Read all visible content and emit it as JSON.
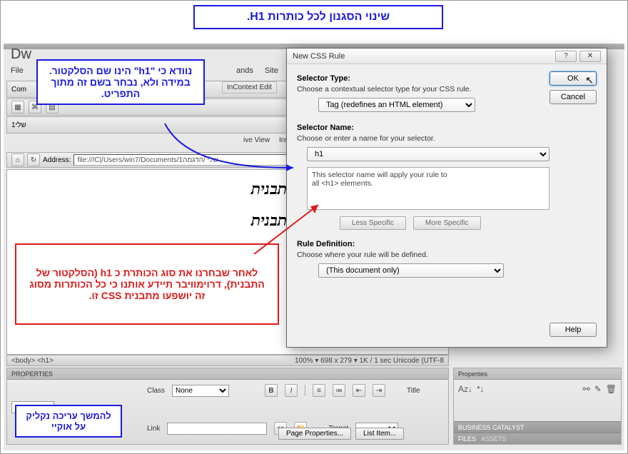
{
  "annotations": {
    "top": "שינוי הסגנון לכל כותרות H1.",
    "note1": "נוודא כי \"h1\" הינו שם הסלקטור. במידה ולא, נבחר בשם זה מתוך התפריט.",
    "note2": "לאחר שבחרנו את סוג הכותרת כ h1 (הסלקטור של התבנית), דרוימוויבר תיידע אותנו כי כל הכותרות מסוג זה יושפעו מתבנית CSS זו.",
    "note3": "להמשך עריכה נקליק על אוקיי"
  },
  "app": {
    "title": "Dw"
  },
  "menu": {
    "file": "File",
    "commands": "ands",
    "site": "Site",
    "incontext": "InContext Edit"
  },
  "toolbar": {
    "common": "Com",
    "tab_sheli": "שלי1",
    "liveview": "ive View",
    "ins": "Ins"
  },
  "addressbar": {
    "label": "Address:",
    "value": "file:///C|/Users/win7/Documents/1שלי /הדגמה"
  },
  "document": {
    "line1": "ות מוגדרות על ידי אותה התבנית",
    "line2": "ות מוגדרות על ידי אותה התבנית"
  },
  "status": {
    "tags": "<body> <h1>",
    "info": "100%  ▾  698 x 279 ▾  1K / 1 sec  Unicode (UTF-8"
  },
  "properties": {
    "title": "PROPERTIES",
    "class_lbl": "Class",
    "class_val": "None",
    "link_lbl": "Link",
    "title_lbl": "Title",
    "target_lbl": "Target",
    "page_props_btn": "Page Properties...",
    "list_item_btn": "List Item..."
  },
  "sidepanel": {
    "props": "Properties",
    "bc": "BUSINESS CATALYST",
    "files": "FILES",
    "assets": "ASSETS"
  },
  "dialog": {
    "title": "New CSS Rule",
    "selector_type_lbl": "Selector Type:",
    "selector_type_sub": "Choose a contextual selector type for your CSS rule.",
    "selector_type_val": "Tag (redefines an HTML element)",
    "selector_name_lbl": "Selector Name:",
    "selector_name_sub": "Choose or enter a name for your selector.",
    "selector_name_val": "h1",
    "preview_text": "This selector name will apply your rule to\nall <h1> elements.",
    "less_specific": "Less Specific",
    "more_specific": "More Specific",
    "rule_def_lbl": "Rule Definition:",
    "rule_def_sub": "Choose where your rule will be defined.",
    "rule_def_val": "(This document only)",
    "ok": "OK",
    "cancel": "Cancel",
    "help": "Help"
  }
}
